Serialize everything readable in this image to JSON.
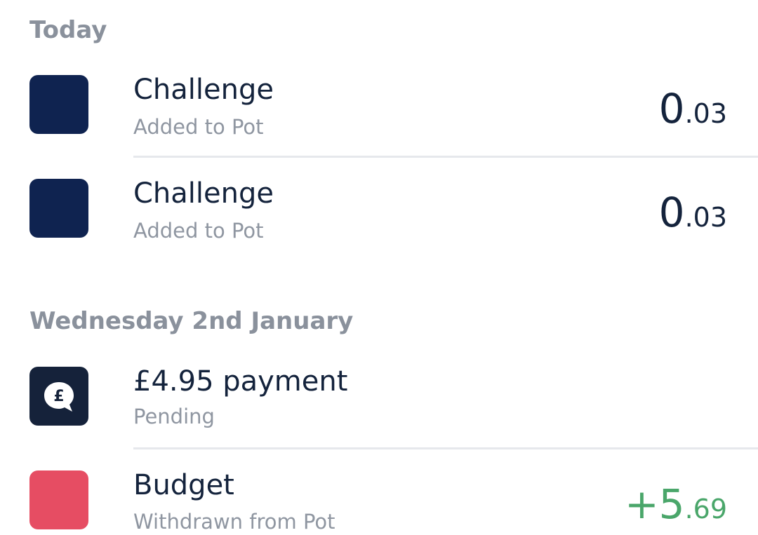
{
  "colors": {
    "pot_navy": "#0f2350",
    "pot_pink": "#e64d63",
    "positive_green": "#4aa66a",
    "title_text": "#14233c",
    "muted_text": "#8f96a1",
    "header_text": "#8a919c",
    "divider": "#e6e8ec",
    "payment_icon_bg": "#15223a"
  },
  "sections": [
    {
      "header": "Today",
      "transactions": [
        {
          "icon": "pot-swatch",
          "title": "Challenge",
          "subtitle": "Added to Pot",
          "amount_major": "0",
          "amount_minor": ".03"
        },
        {
          "icon": "pot-swatch",
          "title": "Challenge",
          "subtitle": "Added to Pot",
          "amount_major": "0",
          "amount_minor": ".03"
        }
      ]
    },
    {
      "header": "Wednesday 2nd January",
      "transactions": [
        {
          "icon": "pound-speech-bubble-icon",
          "title": "£4.95 payment",
          "subtitle": "Pending",
          "amount_major": "",
          "amount_minor": ""
        },
        {
          "icon": "pot-swatch",
          "title": "Budget",
          "subtitle": "Withdrawn from Pot",
          "amount_major": "+5",
          "amount_minor": ".69"
        }
      ]
    }
  ]
}
